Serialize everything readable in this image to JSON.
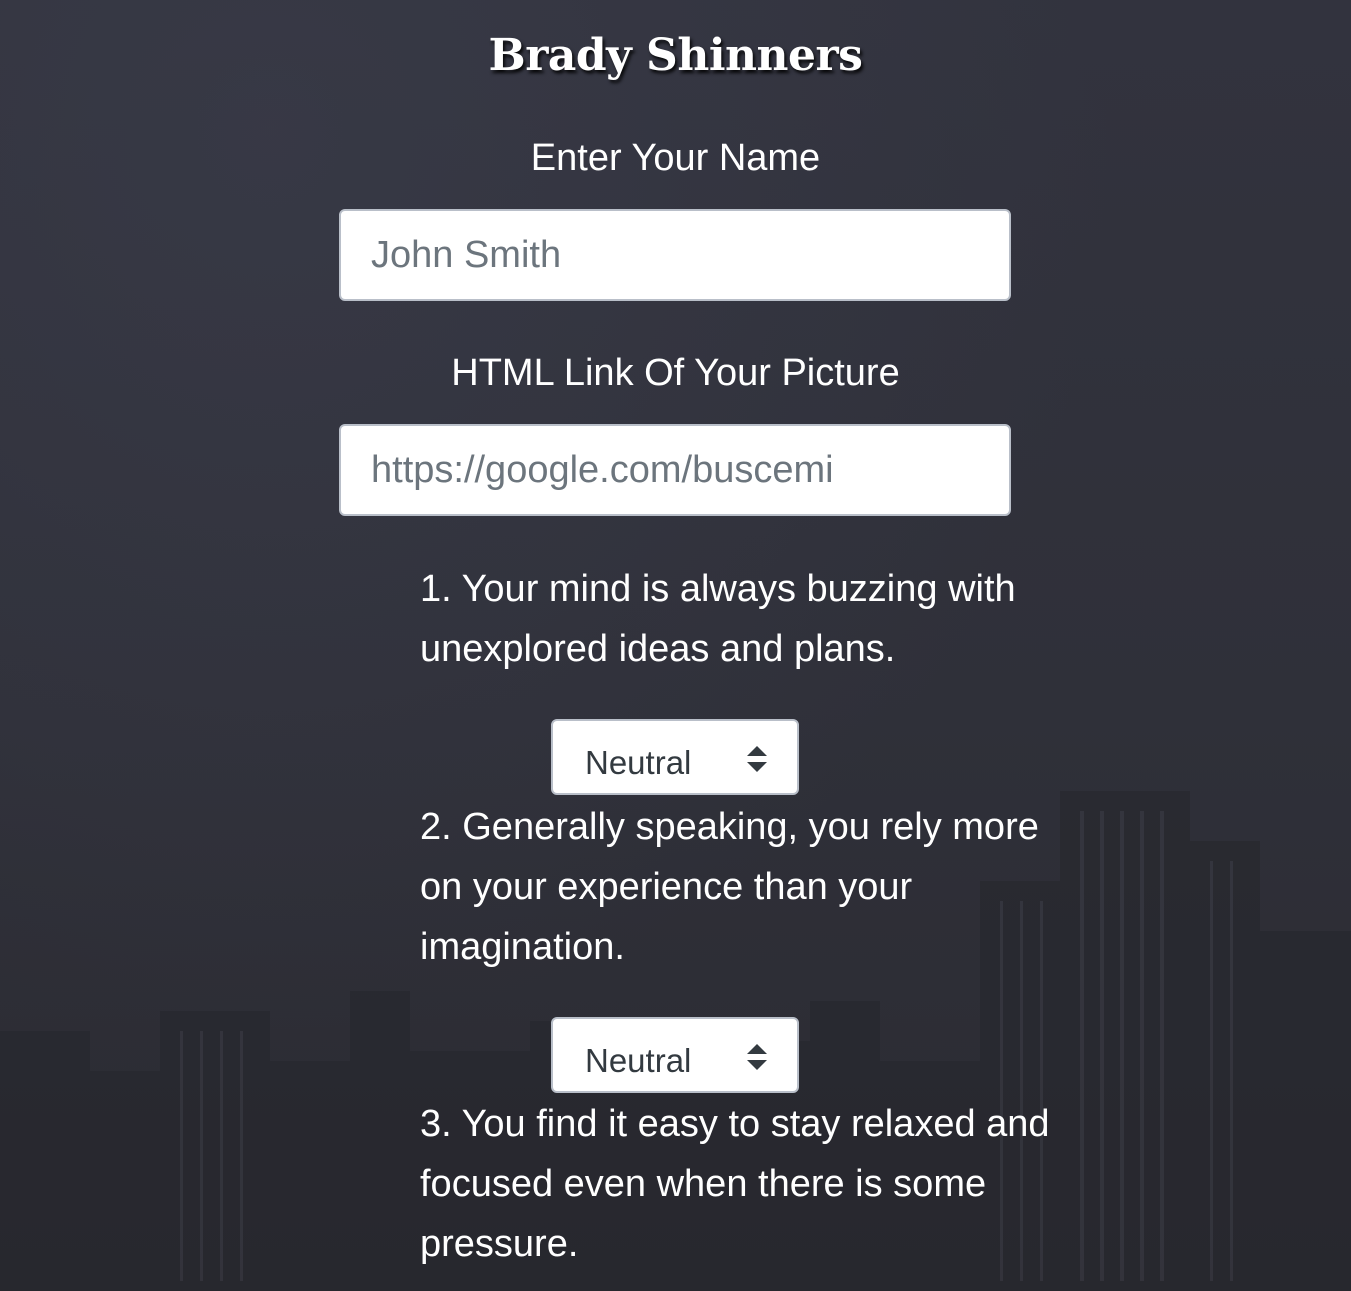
{
  "page": {
    "title": "Brady Shinners"
  },
  "form": {
    "name_label": "Enter Your Name",
    "name_placeholder": "John Smith",
    "name_value": "",
    "picture_label": "HTML Link Of Your Picture",
    "picture_placeholder": "https://google.com/buscemi",
    "picture_value": ""
  },
  "questions": [
    {
      "text": "1. Your mind is always buzzing with unexplored ideas and plans.",
      "selected": "Neutral"
    },
    {
      "text": "2. Generally speaking, you rely more on your experience than your imagination.",
      "selected": "Neutral"
    },
    {
      "text": "3. You find it easy to stay relaxed and focused even when there is some pressure."
    }
  ],
  "icons": {
    "select_arrow": "sort-arrows-icon"
  },
  "colors": {
    "background": "#2f303b",
    "text": "#ffffff",
    "input_border": "#b9bfc9",
    "placeholder": "#6c757d"
  }
}
